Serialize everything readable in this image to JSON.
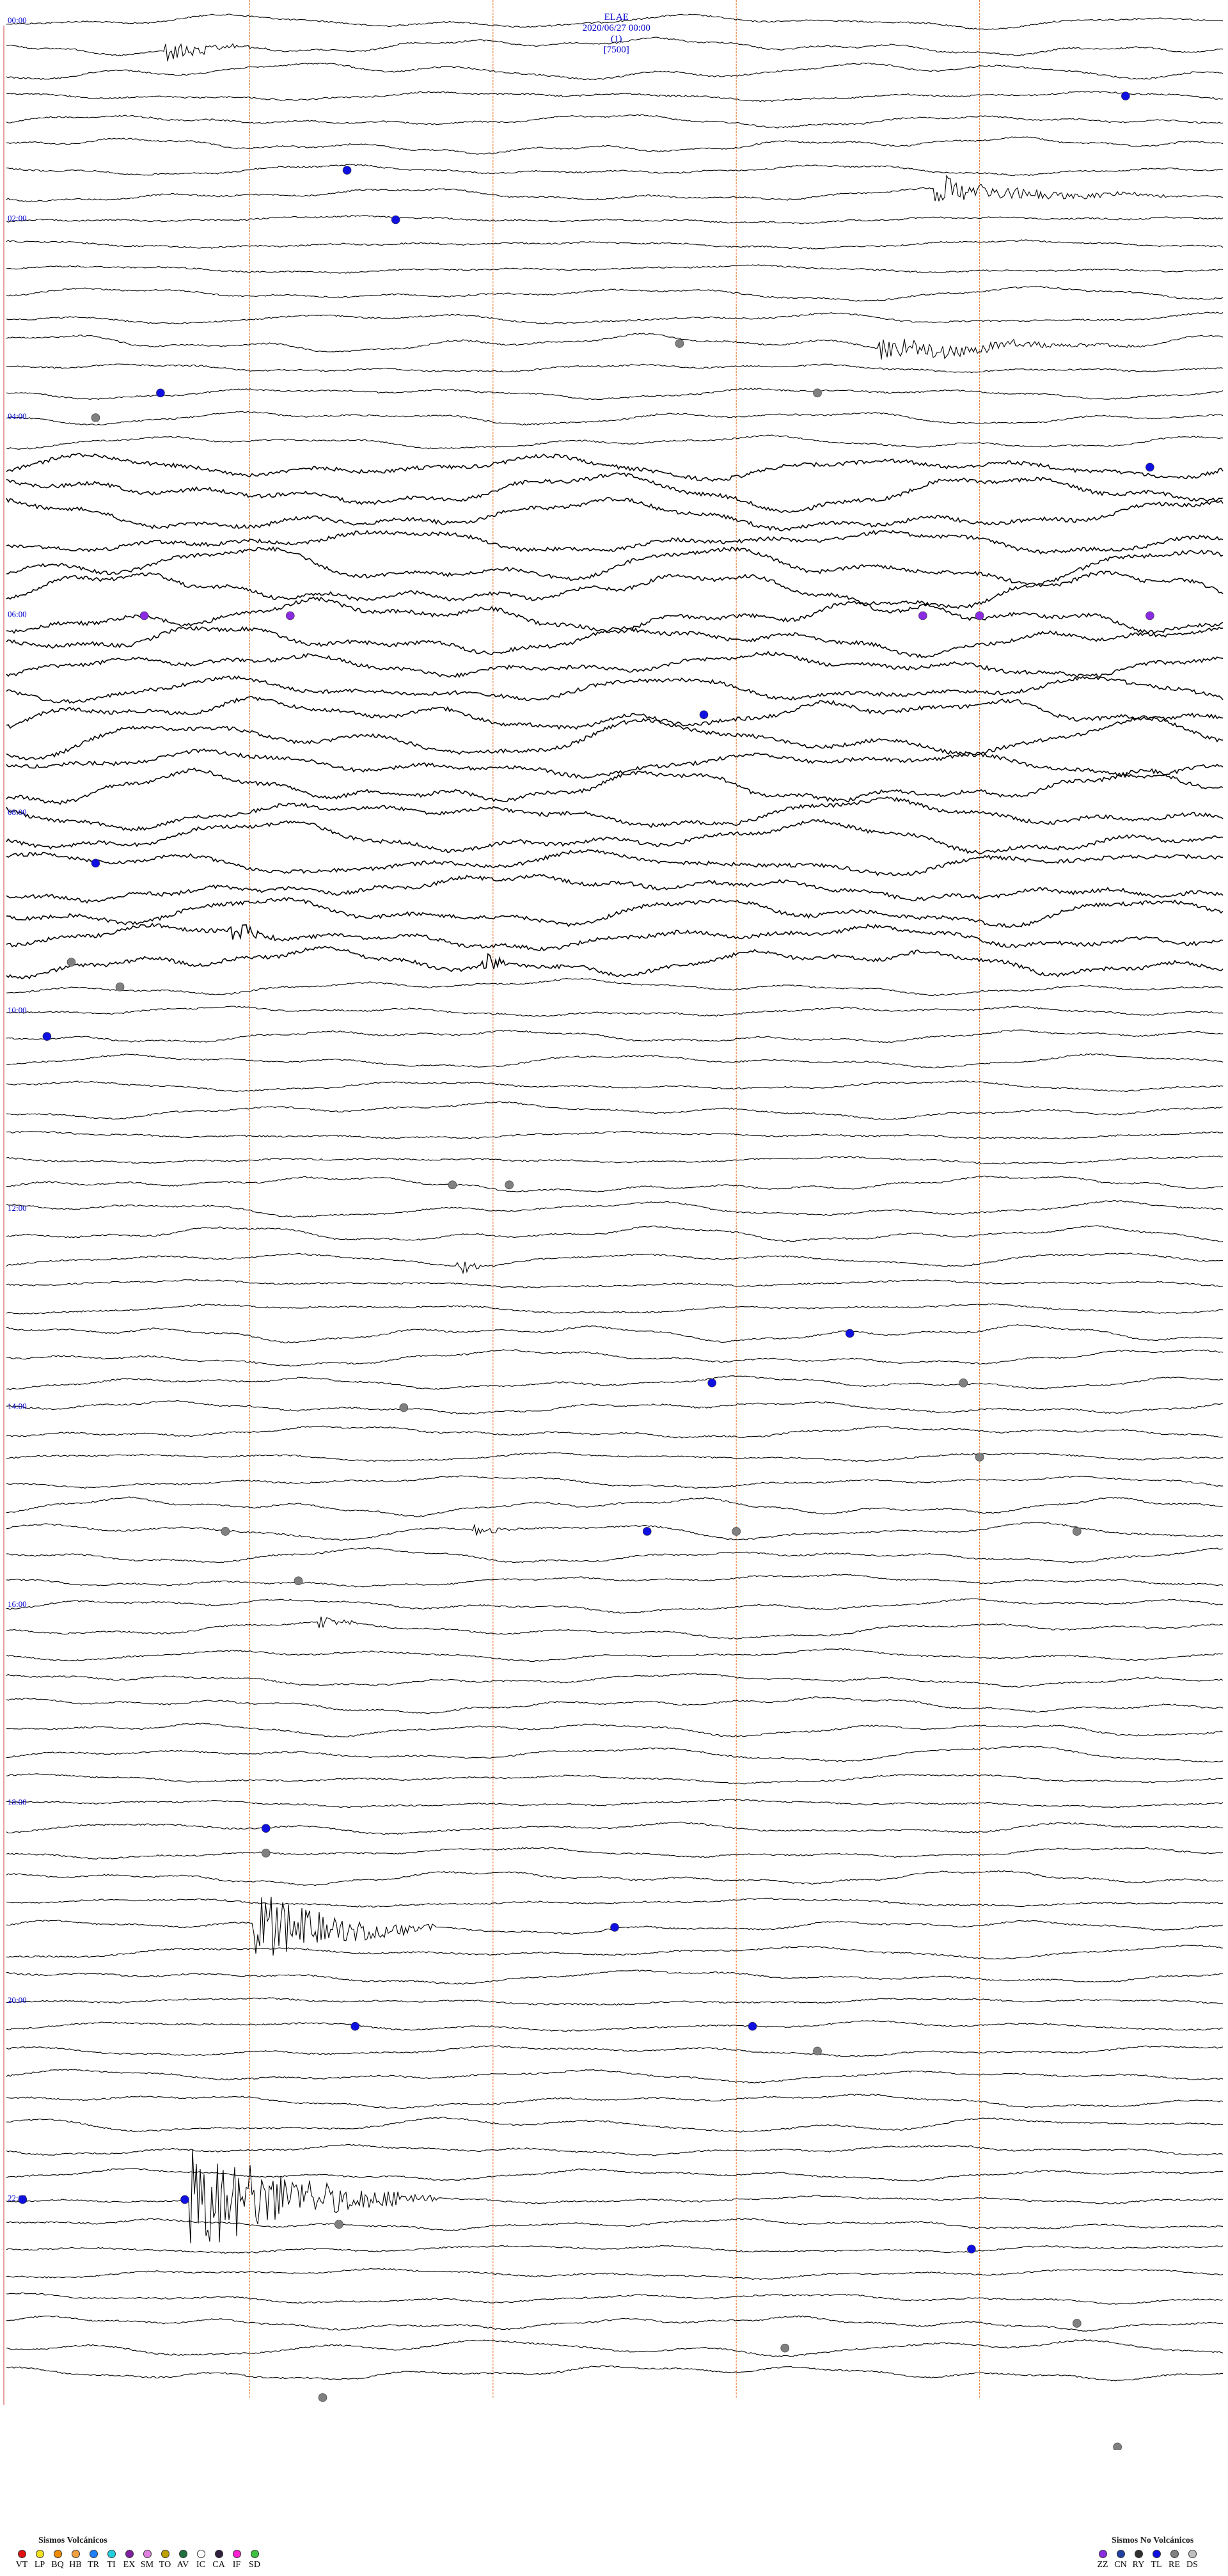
{
  "header": {
    "station": "ELAE",
    "datetime": "2020/06/27 00:00",
    "page": "(1)",
    "scale": "[7500]"
  },
  "chart_data": {
    "type": "helicorder",
    "traces_count": 96,
    "hours": 24,
    "traces_per_hour": 4,
    "minute_markers": [
      3,
      6,
      9,
      12
    ],
    "minutes_per_trace": 15,
    "hour_labels": [
      {
        "hour": 0,
        "text": "00:00"
      },
      {
        "hour": 2,
        "text": "02:00"
      },
      {
        "hour": 4,
        "text": "04:00"
      },
      {
        "hour": 6,
        "text": "06:00"
      },
      {
        "hour": 8,
        "text": "08:00"
      },
      {
        "hour": 10,
        "text": "10:00"
      },
      {
        "hour": 12,
        "text": "12:00"
      },
      {
        "hour": 14,
        "text": "14:00"
      },
      {
        "hour": 16,
        "text": "16:00"
      },
      {
        "hour": 18,
        "text": "18:00"
      },
      {
        "hour": 20,
        "text": "20:00"
      },
      {
        "hour": 22,
        "text": "22:00"
      }
    ],
    "high_noise_traces": [
      18,
      19,
      20,
      21,
      22,
      23,
      24,
      25,
      26,
      27,
      28,
      29,
      30,
      31,
      32,
      33,
      34,
      35,
      36,
      37,
      38
    ],
    "events": [
      {
        "trace": 1,
        "minute": 2.0,
        "amp": 18,
        "dur": 1.2,
        "class": "TR"
      },
      {
        "trace": 7,
        "minute": 11.5,
        "amp": 22,
        "dur": 2.8,
        "class": "TR"
      },
      {
        "trace": 13,
        "minute": 10.8,
        "amp": 20,
        "dur": 3.2,
        "class": "TR"
      },
      {
        "trace": 37,
        "minute": 2.8,
        "amp": 28,
        "dur": 0.6,
        "class": "VT"
      },
      {
        "trace": 38,
        "minute": 5.9,
        "amp": 22,
        "dur": 0.4,
        "class": "VT"
      },
      {
        "trace": 77,
        "minute": 3.1,
        "amp": 60,
        "dur": 2.2,
        "class": "VT"
      },
      {
        "trace": 88,
        "minute": 2.3,
        "amp": 95,
        "dur": 3.0,
        "class": "VT"
      },
      {
        "trace": 50,
        "minute": 5.6,
        "amp": 12,
        "dur": 0.5,
        "class": "VT"
      },
      {
        "trace": 61,
        "minute": 5.8,
        "amp": 10,
        "dur": 0.6,
        "class": "VT"
      },
      {
        "trace": 65,
        "minute": 3.9,
        "amp": 10,
        "dur": 0.6,
        "class": "VT"
      }
    ],
    "markers": [
      {
        "trace": 3,
        "minute": 13.8,
        "class": "TL"
      },
      {
        "trace": 6,
        "minute": 4.2,
        "class": "TL"
      },
      {
        "trace": 8,
        "minute": 4.8,
        "class": "TL"
      },
      {
        "trace": 13,
        "minute": 8.3,
        "class": "RE"
      },
      {
        "trace": 15,
        "minute": 1.9,
        "class": "TL"
      },
      {
        "trace": 15,
        "minute": 10.0,
        "class": "RE"
      },
      {
        "trace": 16,
        "minute": 1.1,
        "class": "RE"
      },
      {
        "trace": 18,
        "minute": 14.1,
        "class": "TL"
      },
      {
        "trace": 24,
        "minute": 1.7,
        "class": "ZZ"
      },
      {
        "trace": 24,
        "minute": 3.5,
        "class": "ZZ"
      },
      {
        "trace": 24,
        "minute": 11.3,
        "class": "ZZ"
      },
      {
        "trace": 24,
        "minute": 12.0,
        "class": "ZZ"
      },
      {
        "trace": 24,
        "minute": 14.1,
        "class": "ZZ"
      },
      {
        "trace": 28,
        "minute": 8.6,
        "class": "TL"
      },
      {
        "trace": 34,
        "minute": 1.1,
        "class": "TL"
      },
      {
        "trace": 38,
        "minute": 0.8,
        "class": "RE"
      },
      {
        "trace": 39,
        "minute": 1.4,
        "class": "RE"
      },
      {
        "trace": 41,
        "minute": 0.5,
        "class": "TL"
      },
      {
        "trace": 47,
        "minute": 5.5,
        "class": "RE"
      },
      {
        "trace": 47,
        "minute": 6.2,
        "class": "RE"
      },
      {
        "trace": 53,
        "minute": 10.4,
        "class": "TL"
      },
      {
        "trace": 55,
        "minute": 11.8,
        "class": "RE"
      },
      {
        "trace": 55,
        "minute": 8.7,
        "class": "TL"
      },
      {
        "trace": 56,
        "minute": 4.9,
        "class": "RE"
      },
      {
        "trace": 58,
        "minute": 12.0,
        "class": "RE"
      },
      {
        "trace": 61,
        "minute": 2.7,
        "class": "RE"
      },
      {
        "trace": 61,
        "minute": 7.9,
        "class": "TL"
      },
      {
        "trace": 61,
        "minute": 9.0,
        "class": "RE"
      },
      {
        "trace": 61,
        "minute": 13.2,
        "class": "RE"
      },
      {
        "trace": 63,
        "minute": 3.6,
        "class": "RE"
      },
      {
        "trace": 73,
        "minute": 3.2,
        "class": "TL"
      },
      {
        "trace": 74,
        "minute": 3.2,
        "class": "RE"
      },
      {
        "trace": 77,
        "minute": 7.5,
        "class": "TL"
      },
      {
        "trace": 81,
        "minute": 4.3,
        "class": "TL"
      },
      {
        "trace": 81,
        "minute": 9.2,
        "class": "TL"
      },
      {
        "trace": 82,
        "minute": 10.0,
        "class": "RE"
      },
      {
        "trace": 88,
        "minute": 0.2,
        "class": "TL"
      },
      {
        "trace": 88,
        "minute": 2.2,
        "class": "TL"
      },
      {
        "trace": 89,
        "minute": 4.1,
        "class": "RE"
      },
      {
        "trace": 90,
        "minute": 11.9,
        "class": "TL"
      },
      {
        "trace": 93,
        "minute": 13.2,
        "class": "RE"
      },
      {
        "trace": 94,
        "minute": 9.6,
        "class": "RE"
      },
      {
        "trace": 96,
        "minute": 3.9,
        "class": "RE"
      },
      {
        "trace": 98,
        "minute": 13.7,
        "class": "RE"
      },
      {
        "trace": 99,
        "minute": 0.6,
        "class": "RE"
      },
      {
        "trace": 99,
        "minute": 8.4,
        "class": "RE"
      },
      {
        "trace": 100,
        "minute": 3.6,
        "class": "RE"
      }
    ]
  },
  "legend_volcanic": {
    "title": "Sismos Volcánicos",
    "items": [
      {
        "code": "VT",
        "color": "#e01010"
      },
      {
        "code": "LP",
        "color": "#f0e020"
      },
      {
        "code": "BQ",
        "color": "#f08a00"
      },
      {
        "code": "HB",
        "color": "#f0a040"
      },
      {
        "code": "TR",
        "color": "#2080ff"
      },
      {
        "code": "TI",
        "color": "#20d0e0"
      },
      {
        "code": "EX",
        "color": "#8020a0"
      },
      {
        "code": "SM",
        "color": "#e080e0"
      },
      {
        "code": "TO",
        "color": "#c0a000"
      },
      {
        "code": "AV",
        "color": "#207040"
      },
      {
        "code": "IC",
        "color": "#ffffff"
      },
      {
        "code": "CA",
        "color": "#302040"
      },
      {
        "code": "IF",
        "color": "#ff20d0"
      },
      {
        "code": "SD",
        "color": "#40c040"
      }
    ]
  },
  "legend_nonvolcanic": {
    "title": "Sismos No Volcánicos",
    "items": [
      {
        "code": "ZZ",
        "color": "#8a2be2"
      },
      {
        "code": "CN",
        "color": "#2040a0"
      },
      {
        "code": "RY",
        "color": "#303030"
      },
      {
        "code": "TL",
        "color": "#1010e0"
      },
      {
        "code": "RE",
        "color": "#808080"
      },
      {
        "code": "DS",
        "color": "#c0c0c0"
      }
    ]
  }
}
